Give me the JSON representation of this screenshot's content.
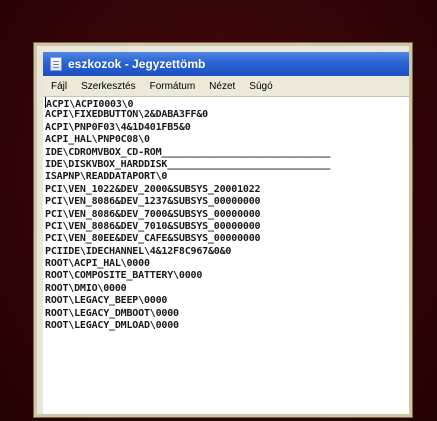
{
  "window": {
    "title": "eszkozok - Jegyzettömb"
  },
  "menu": {
    "items": [
      {
        "label": "Fájl"
      },
      {
        "label": "Szerkesztés"
      },
      {
        "label": "Formátum"
      },
      {
        "label": "Nézet"
      },
      {
        "label": "Súgó"
      }
    ]
  },
  "editor": {
    "lines": [
      "ACPI\\ACPI0003\\0",
      "ACPI\\FIXEDBUTTON\\2&DABA3FF&0",
      "ACPI\\PNP0F03\\4&1D401FB5&0",
      "ACPI_HAL\\PNP0C08\\0",
      "IDE\\CDROMVBOX_CD-ROM_____________________________",
      "IDE\\DISKVBOX_HARDDISK____________________________",
      "ISAPNP\\READDATAPORT\\0",
      "PCI\\VEN_1022&DEV_2000&SUBSYS_20001022",
      "PCI\\VEN_8086&DEV_1237&SUBSYS_00000000",
      "PCI\\VEN_8086&DEV_7000&SUBSYS_00000000",
      "PCI\\VEN_8086&DEV_7010&SUBSYS_00000000",
      "PCI\\VEN_80EE&DEV_CAFE&SUBSYS_00000000",
      "PCIIDE\\IDECHANNEL\\4&12F8C967&0&0",
      "ROOT\\ACPI_HAL\\0000",
      "ROOT\\COMPOSITE_BATTERY\\0000",
      "ROOT\\DMIO\\0000",
      "ROOT\\LEGACY_BEEP\\0000",
      "ROOT\\LEGACY_DMBOOT\\0000",
      "ROOT\\LEGACY_DMLOAD\\0000"
    ]
  }
}
